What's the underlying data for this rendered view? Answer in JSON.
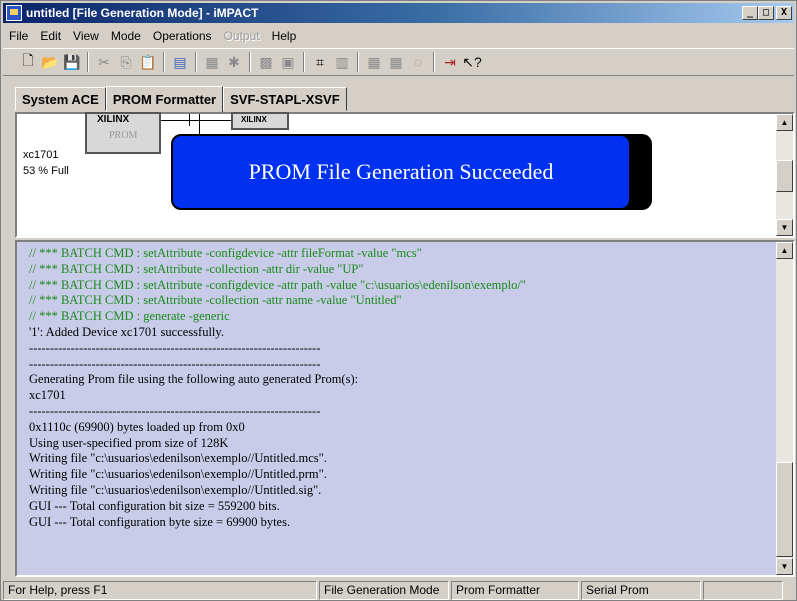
{
  "window": {
    "title": "untitled [File Generation Mode] - iMPACT",
    "minimize": "_",
    "restore": "□",
    "close": "X"
  },
  "menu": [
    "File",
    "Edit",
    "View",
    "Mode",
    "Operations",
    "Output",
    "Help"
  ],
  "toolbar": {
    "icons": [
      "new-icon",
      "open-icon",
      "save-icon",
      "cut-icon",
      "copy-icon",
      "paste-icon",
      "prom-icon",
      "grid-icon",
      "cross-grid-icon",
      "tiles-icon",
      "tiles2-icon",
      "chip-icon",
      "table-icon",
      "chain-icon",
      "chain2-icon",
      "circle-icon",
      "exit-icon",
      "help-pointer-icon"
    ]
  },
  "tabs": [
    {
      "label": "System ACE"
    },
    {
      "label": "PROM Formatter"
    },
    {
      "label": "SVF-STAPL-XSVF"
    }
  ],
  "device": {
    "chip1_logo": "XILINX",
    "chip1_type": "PROM",
    "chip2_logo": "XILINX",
    "name": "xc1701",
    "fill": "53 % Full"
  },
  "banner": "PROM File Generation Succeeded",
  "log": [
    {
      "text": "// *** BATCH CMD : setAttribute -configdevice -attr fileFormat -value \"mcs\"",
      "green": true
    },
    {
      "text": "// *** BATCH CMD : setAttribute -collection -attr dir -value \"UP\"",
      "green": true
    },
    {
      "text": "// *** BATCH CMD : setAttribute -configdevice -attr path -value \"c:\\usuarios\\edenilson\\exemplo/\"",
      "green": true
    },
    {
      "text": "// *** BATCH CMD : setAttribute -collection -attr name -value \"Untitled\"",
      "green": true
    },
    {
      "text": "// *** BATCH CMD : generate -generic",
      "green": true
    },
    {
      "text": "'1': Added Device xc1701 successfully.",
      "green": false
    },
    {
      "text": "----------------------------------------------------------------------",
      "green": false
    },
    {
      "text": "----------------------------------------------------------------------",
      "green": false
    },
    {
      "text": "Generating Prom file using the following auto generated Prom(s):",
      "green": false
    },
    {
      "text": "xc1701",
      "green": false
    },
    {
      "text": "----------------------------------------------------------------------",
      "green": false
    },
    {
      "text": "0x1110c (69900) bytes loaded up from 0x0",
      "green": false
    },
    {
      "text": "Using user-specified prom size of 128K",
      "green": false
    },
    {
      "text": "Writing file \"c:\\usuarios\\edenilson\\exemplo//Untitled.mcs\".",
      "green": false
    },
    {
      "text": "Writing file \"c:\\usuarios\\edenilson\\exemplo//Untitled.prm\".",
      "green": false
    },
    {
      "text": "Writing file \"c:\\usuarios\\edenilson\\exemplo//Untitled.sig\".",
      "green": false
    },
    {
      "text": "GUI --- Total configuration bit size = 559200 bits.",
      "green": false
    },
    {
      "text": "GUI --- Total configuration byte size = 69900 bytes.",
      "green": false
    }
  ],
  "status": {
    "help": "For Help, press F1",
    "mode": "File Generation Mode",
    "formatter": "Prom Formatter",
    "prom": "Serial Prom"
  },
  "colors": {
    "banner": "#0030f0",
    "log_bg": "#c8cce8",
    "green_text": "#1a8a1a"
  }
}
